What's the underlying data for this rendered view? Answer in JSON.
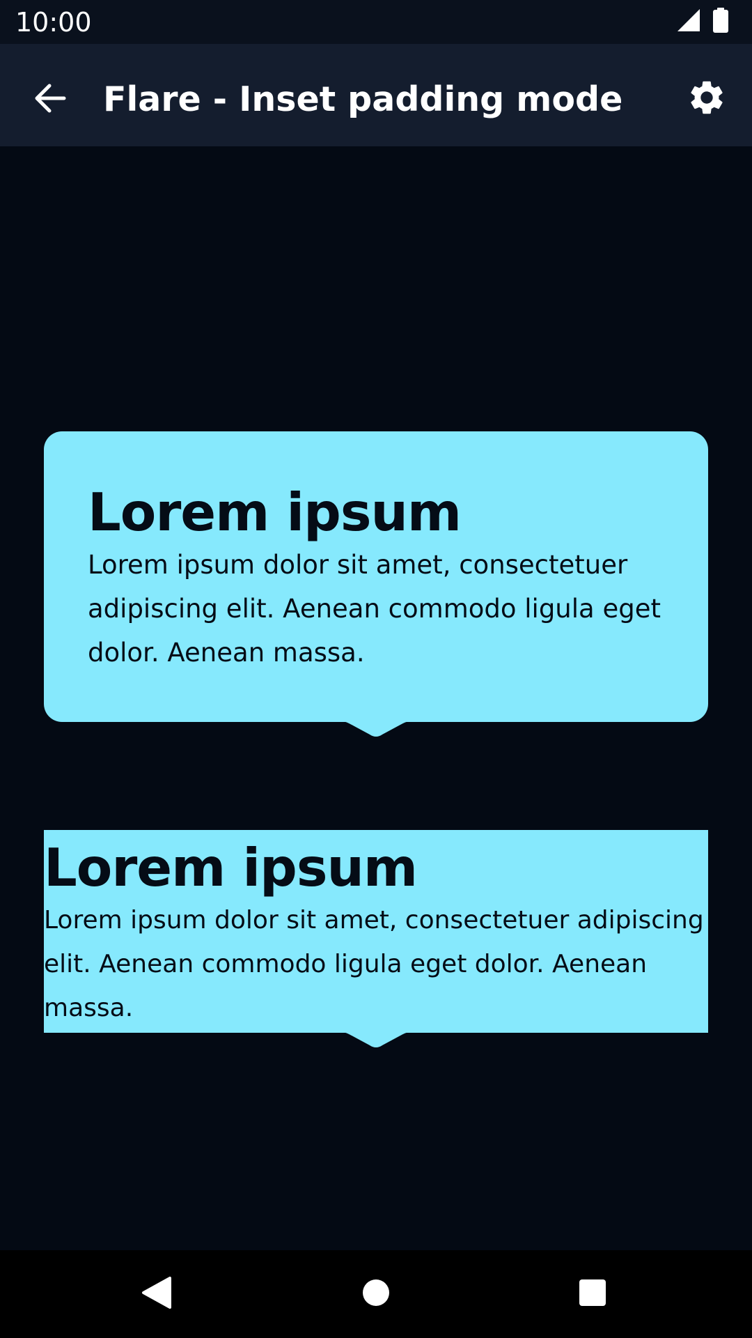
{
  "status_bar": {
    "time": "10:00",
    "icons": [
      "cell-signal-icon",
      "battery-icon"
    ]
  },
  "app_bar": {
    "title": "Flare - Inset padding mode",
    "back_icon": "arrow-back-icon",
    "settings_icon": "gear-icon"
  },
  "tooltips": [
    {
      "title": "Lorem ipsum",
      "body": "Lorem ipsum dolor sit amet, consectetuer adipiscing elit. Aenean commodo ligula eget dolor. Aenean massa."
    },
    {
      "title": "Lorem ipsum",
      "body": "Lorem ipsum dolor sit amet, consectetuer adipiscing elit. Aenean commodo ligula eget dolor. Aenean massa."
    }
  ],
  "nav_bar": {
    "icons": [
      "back-triangle-icon",
      "home-circle-icon",
      "recents-square-icon"
    ]
  },
  "colors": {
    "background": "#040a14",
    "app_bar": "#141d2e",
    "tooltip": "#86e9fd",
    "tooltip_text": "#050c16"
  }
}
